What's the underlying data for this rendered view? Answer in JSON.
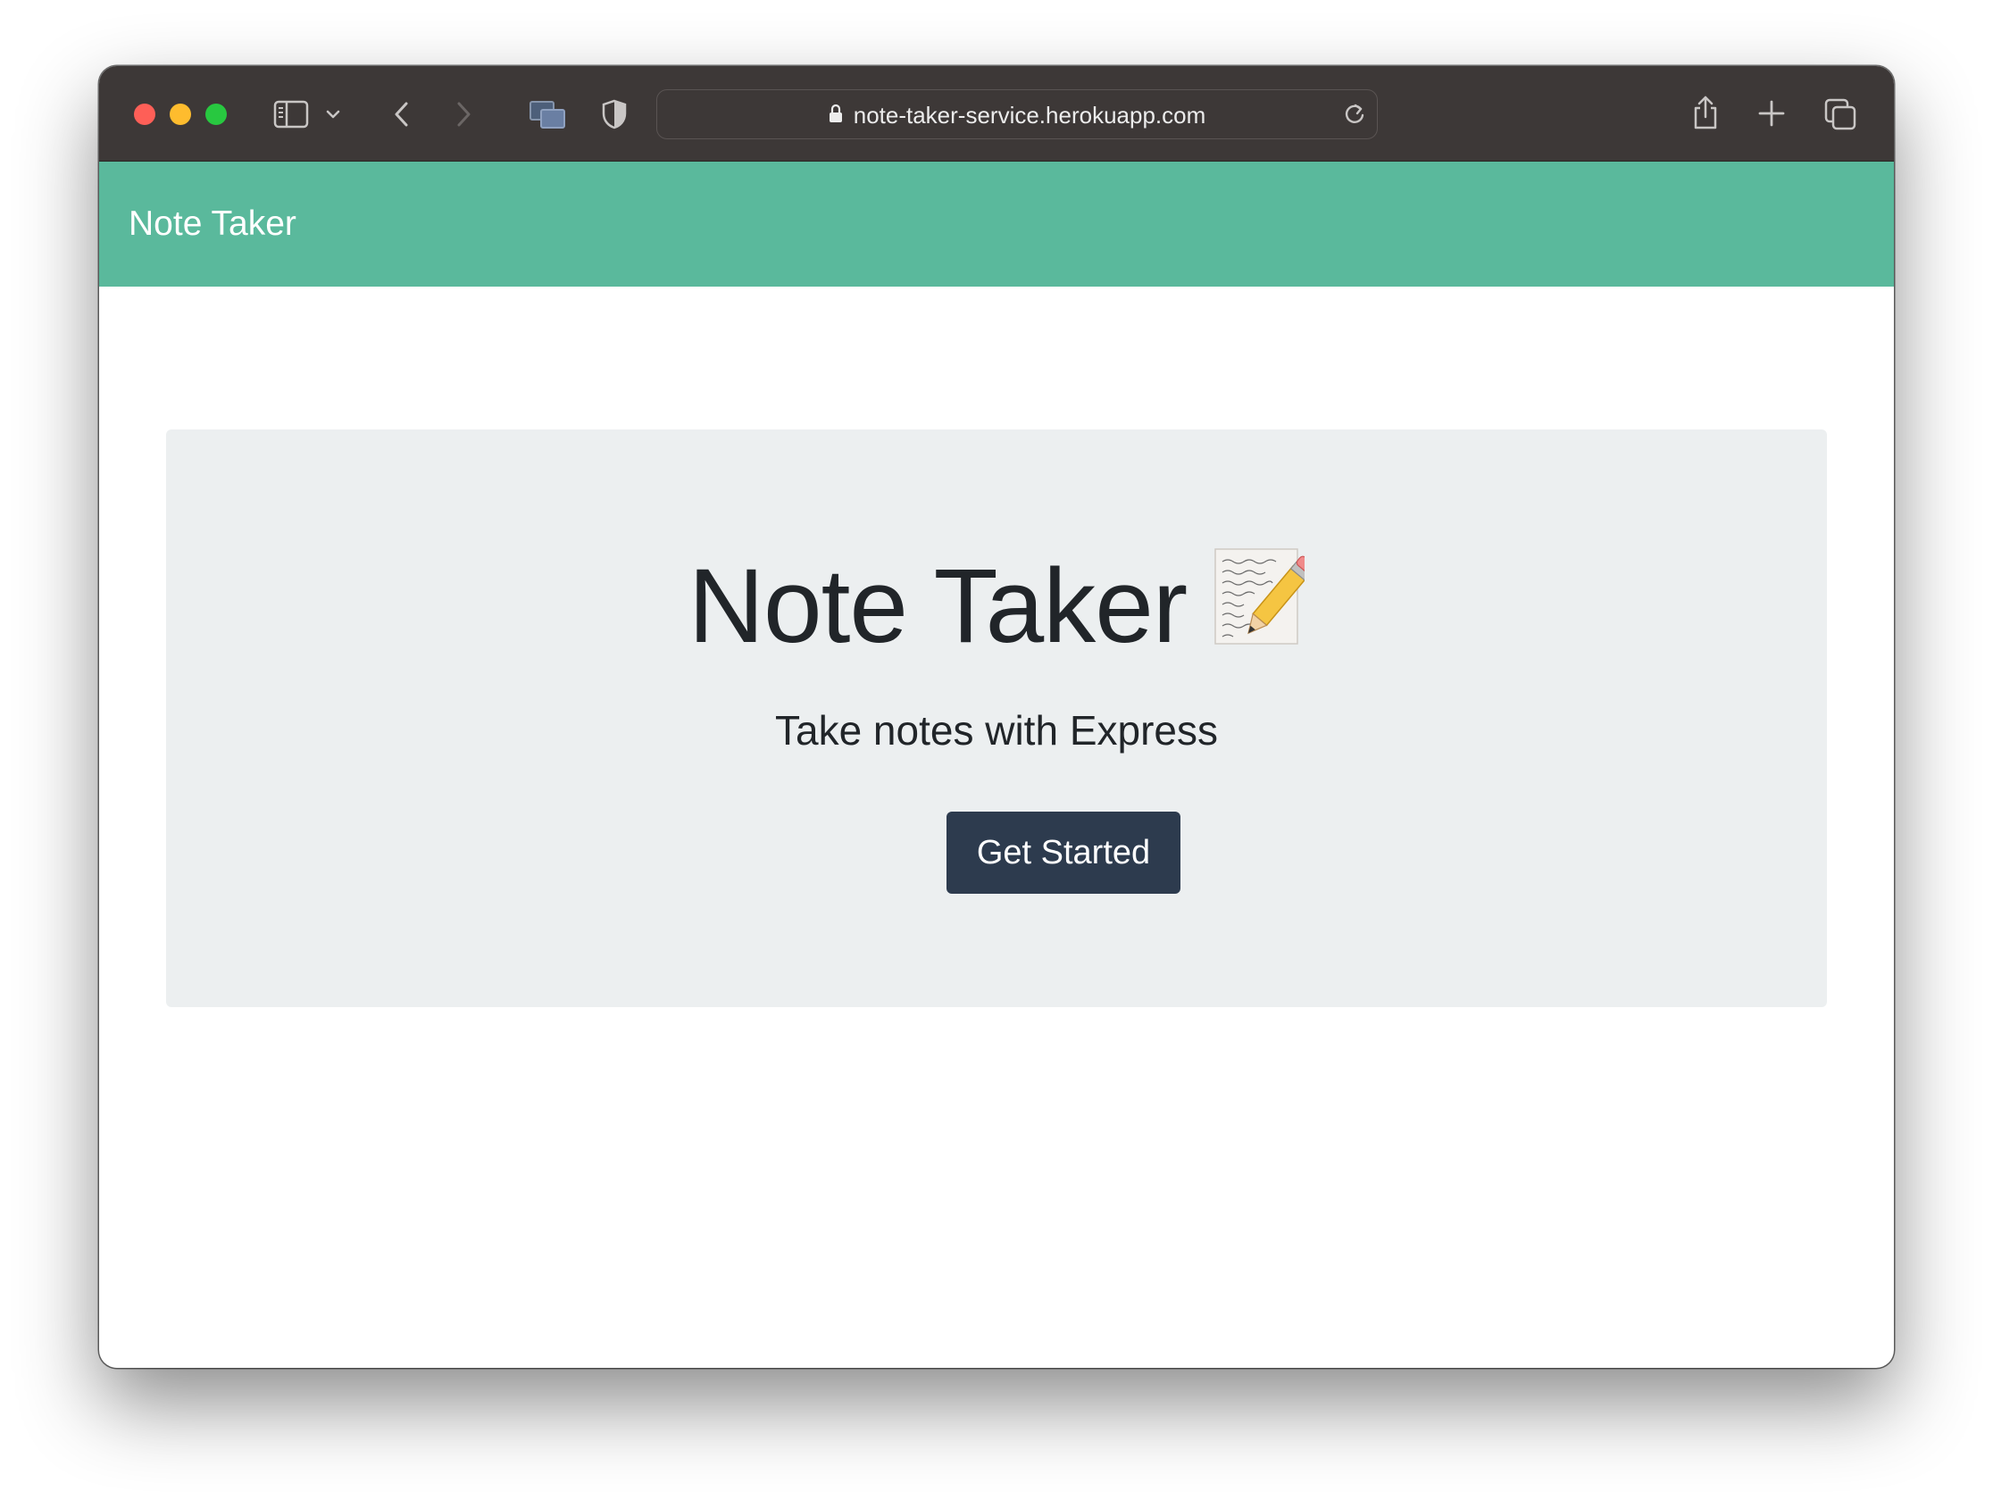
{
  "browser": {
    "url": "note-taker-service.herokuapp.com",
    "icons": [
      "sidebar-icon",
      "chevron-down-icon",
      "back-icon",
      "forward-icon",
      "tab-overview-icon",
      "privacy-shield-icon",
      "lock-icon",
      "reload-icon",
      "share-icon",
      "new-tab-icon",
      "tabs-icon"
    ]
  },
  "navbar": {
    "brand": "Note Taker",
    "color": "#5ab99c"
  },
  "hero": {
    "title": "Note Taker",
    "emoji_icon": "memo-icon",
    "subtitle": "Take notes with Express",
    "button_label": "Get Started",
    "button_color": "#2d3b4e",
    "background": "#eceff0"
  }
}
